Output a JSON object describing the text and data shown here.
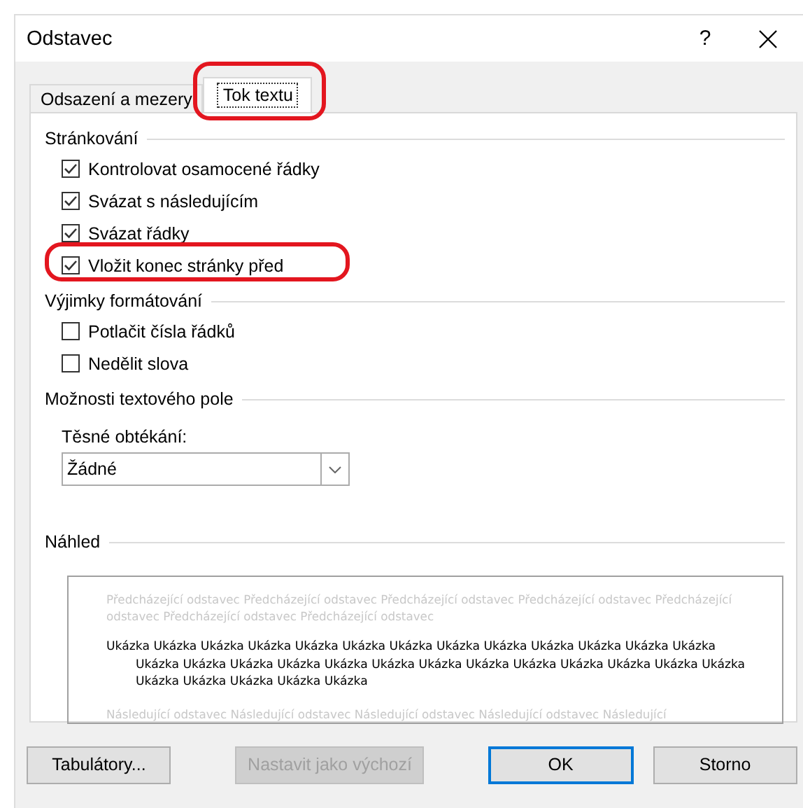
{
  "window": {
    "title": "Odstavec",
    "help": "?"
  },
  "tabs": [
    {
      "label": "Odsazení a mezery",
      "selected": false,
      "highlighted": false
    },
    {
      "label": "Tok textu",
      "selected": true,
      "highlighted": true
    }
  ],
  "sections": [
    {
      "kind": "checkboxes",
      "heading": "Stránkování",
      "items": [
        {
          "label": "Kontrolovat osamocené řádky",
          "checked": true,
          "highlighted": false
        },
        {
          "label": "Svázat s následujícím",
          "checked": true,
          "highlighted": false
        },
        {
          "label": "Svázat řádky",
          "checked": true,
          "highlighted": false
        },
        {
          "label": "Vložit konec stránky před",
          "checked": true,
          "highlighted": true
        }
      ]
    },
    {
      "kind": "checkboxes",
      "heading": "Výjimky formátování",
      "items": [
        {
          "label": "Potlačit čísla řádků",
          "checked": false,
          "highlighted": false
        },
        {
          "label": "Nedělit slova",
          "checked": false,
          "highlighted": false
        }
      ]
    },
    {
      "kind": "dropdown",
      "heading": "Možnosti textového pole",
      "label": "Těsné obtékání:",
      "value": "Žádné"
    },
    {
      "kind": "preview",
      "heading": "Náhled",
      "preceding": "Předcházející odstavec Předcházející odstavec Předcházející odstavec Předcházející odstavec Předcházející odstavec Předcházející odstavec Předcházející odstavec",
      "sample": "Ukázka Ukázka Ukázka Ukázka Ukázka Ukázka Ukázka Ukázka Ukázka Ukázka Ukázka Ukázka Ukázka Ukázka Ukázka Ukázka Ukázka Ukázka Ukázka Ukázka Ukázka Ukázka Ukázka Ukázka Ukázka Ukázka Ukázka Ukázka Ukázka Ukázka Ukázka",
      "following": "Následující odstavec Následující odstavec Následující odstavec Následující odstavec Následující"
    }
  ],
  "buttons": [
    {
      "label": "Tabulátory...",
      "disabled": false,
      "default": false
    },
    {
      "label": "Nastavit jako výchozí",
      "disabled": true,
      "default": false
    },
    {
      "label": "OK",
      "disabled": false,
      "default": true
    },
    {
      "label": "Storno",
      "disabled": false,
      "default": false
    }
  ]
}
